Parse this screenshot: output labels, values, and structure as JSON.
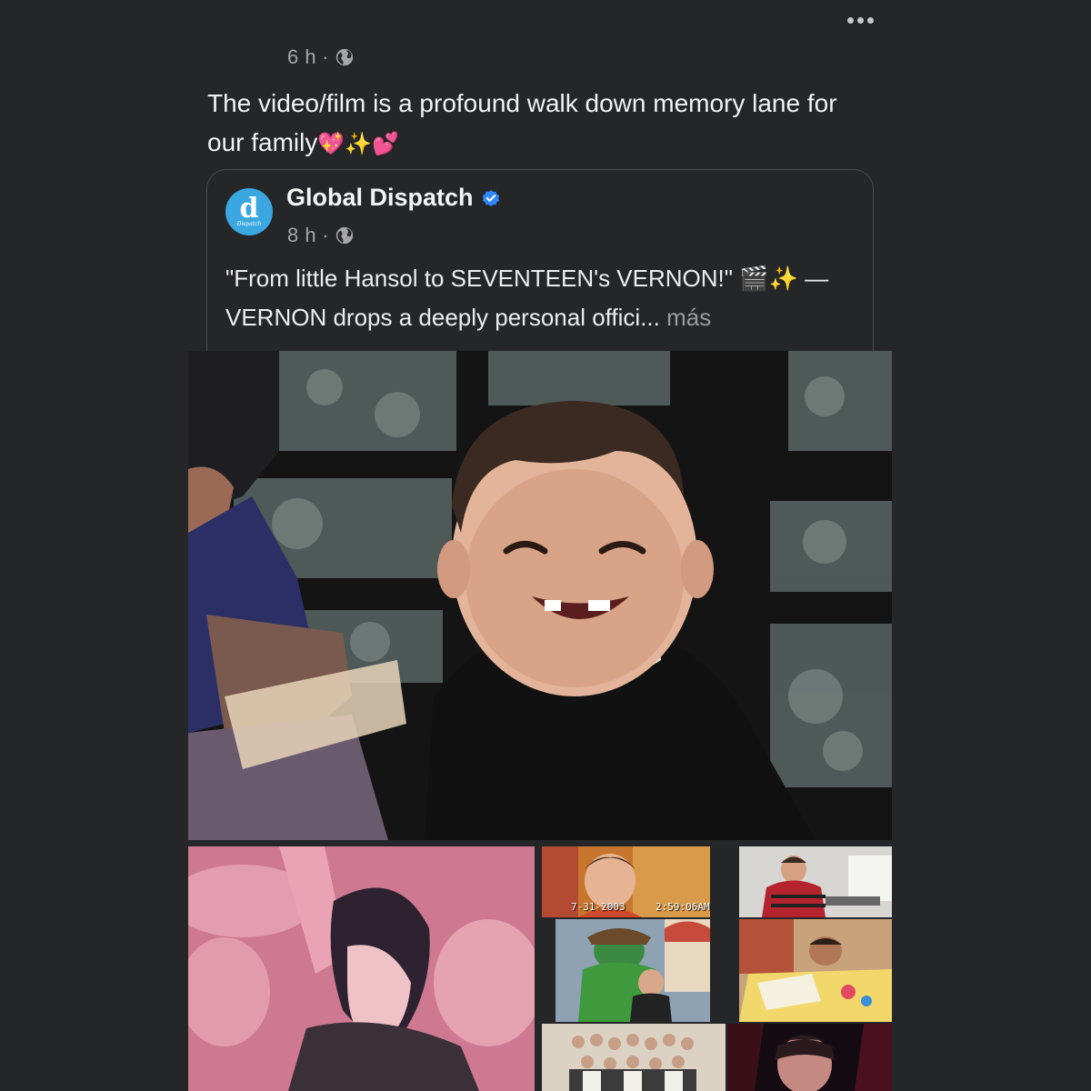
{
  "header": {
    "more_icon": "more-horizontal-icon"
  },
  "post": {
    "time": "6 h",
    "separator": "·",
    "privacy_icon": "globe-icon",
    "text": "The video/film is a profound walk down memory lane for our family",
    "emojis": [
      "💖",
      "✨",
      "💕"
    ]
  },
  "shared": {
    "author": "Global Dispatch",
    "avatar_letter": "d",
    "avatar_sub": "Dispatch",
    "verified_icon": "verified-badge-icon",
    "time": "8 h",
    "separator": "·",
    "privacy_icon": "globe-icon",
    "text_line1": "\"From little Hansol to SEVENTEEN's VERNON!\" 🎬✨ —",
    "text_line2": "VERNON drops a deeply personal offici...",
    "more_label": "más"
  },
  "media": {
    "stamp_date": "7-31-2003",
    "stamp_time": "2:59:06AM"
  },
  "colors": {
    "background": "#252628",
    "accent_blue": "#3aa7e1",
    "verified_blue": "#2d88ff",
    "muted_text": "#a6a6a6"
  }
}
